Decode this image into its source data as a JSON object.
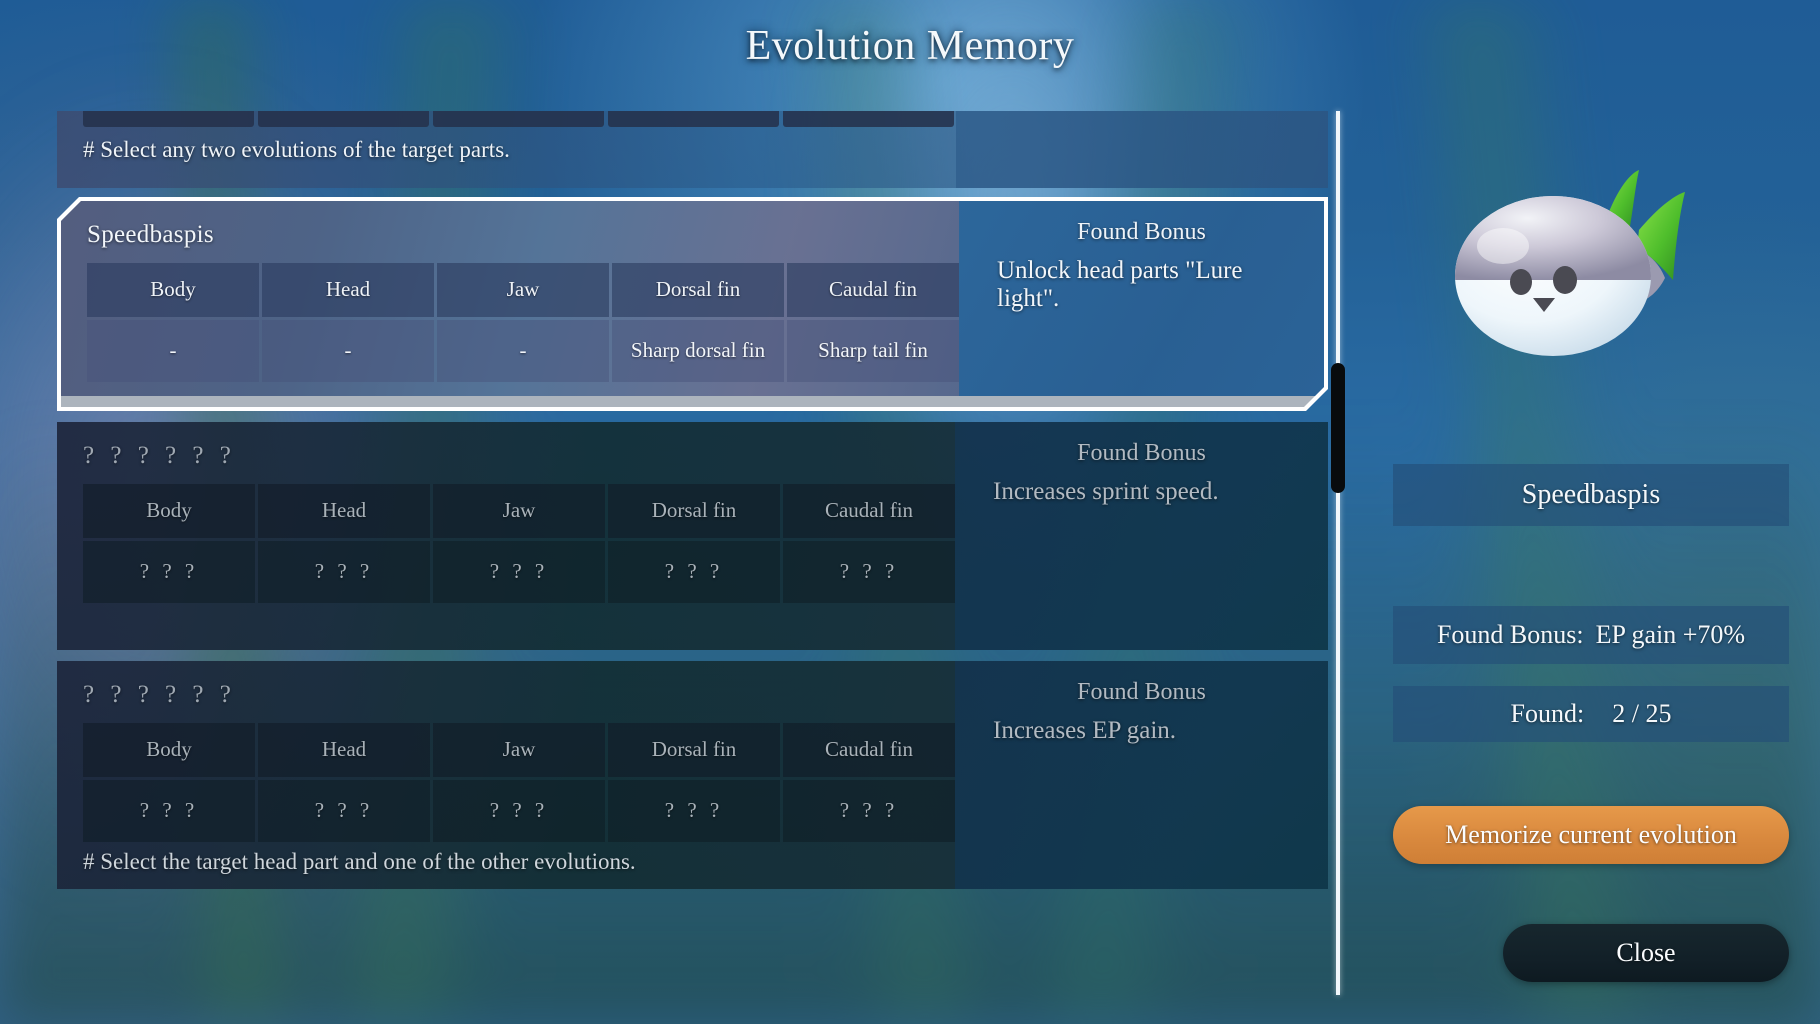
{
  "title": "Evolution Memory",
  "hints": {
    "top": "# Select any two evolutions of the target parts.",
    "bottom": "# Select the target head part and one of the other evolutions."
  },
  "columns": [
    "Body",
    "Head",
    "Jaw",
    "Dorsal fin",
    "Caudal fin"
  ],
  "bonus_label": "Found Bonus",
  "cards": [
    {
      "name": "Speedbaspis",
      "state": "found",
      "selected": true,
      "values": [
        "-",
        "-",
        "-",
        "Sharp dorsal fin",
        "Sharp tail fin"
      ],
      "bonus_label": "Found Bonus",
      "bonus_text": "Unlock head parts \"Lure light\"."
    },
    {
      "name": "? ? ? ? ? ?",
      "state": "unknown",
      "selected": false,
      "values": [
        "? ? ?",
        "? ? ?",
        "? ? ?",
        "? ? ?",
        "? ? ?"
      ],
      "bonus_label": "Found Bonus",
      "bonus_text": "Increases sprint speed."
    },
    {
      "name": "? ? ? ? ? ?",
      "state": "unknown",
      "selected": false,
      "values": [
        "? ? ?",
        "? ? ?",
        "? ? ?",
        "? ? ?",
        "? ? ?"
      ],
      "bonus_label": "Found Bonus",
      "bonus_text": "Increases EP gain."
    }
  ],
  "right_panel": {
    "creature_name": "Speedbaspis",
    "bonus_caption": "Found Bonus:",
    "bonus_value": "EP gain +70%",
    "found_caption": "Found:",
    "found_value": "2 / 25",
    "memorize_label": "Memorize current evolution",
    "close_label": "Close"
  },
  "colors": {
    "accent_orange": "#d9893e",
    "panel_blue": "#24507a",
    "selection_border": "#ffffff",
    "water_blue": "#2a6ca4"
  }
}
